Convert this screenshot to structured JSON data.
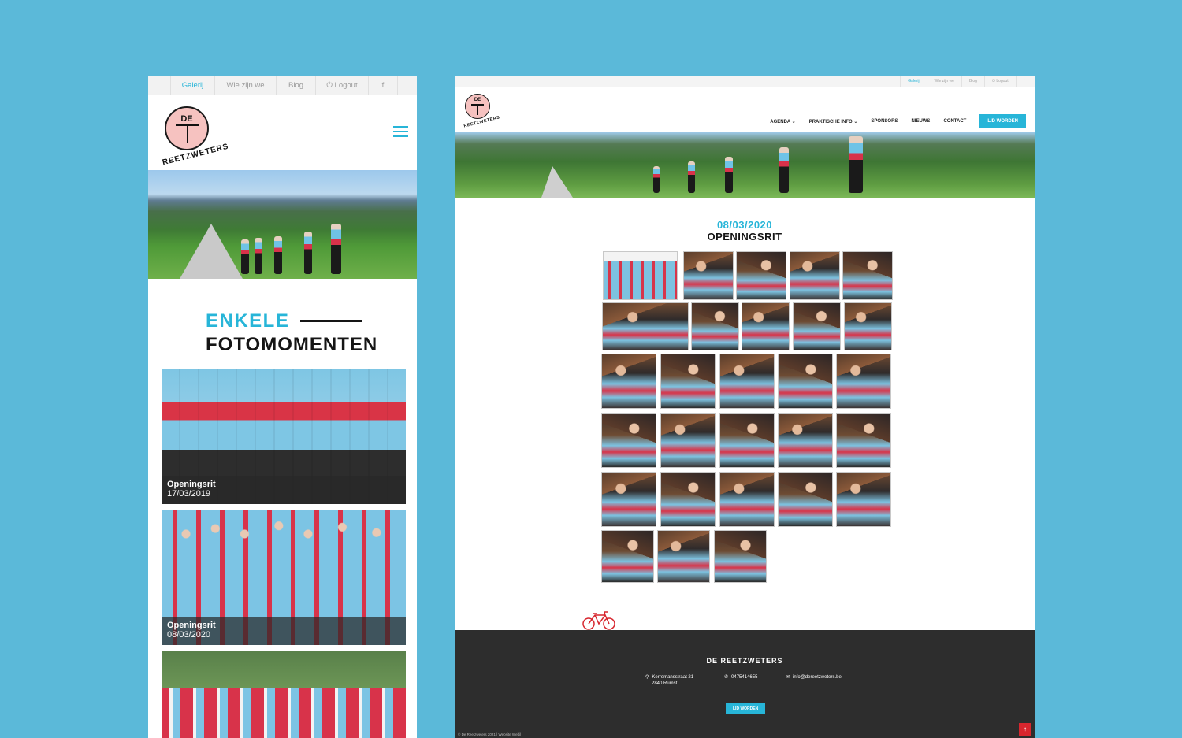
{
  "colors": {
    "background": "#5bb9d9",
    "accent": "#27b5d8",
    "danger": "#d7262e"
  },
  "mobile": {
    "topbar": {
      "tabs": [
        {
          "label": "Galerij",
          "active": true
        },
        {
          "label": "Wie zijn we"
        },
        {
          "label": "Blog"
        },
        {
          "label": "⏻ Logout"
        },
        {
          "label": "f",
          "icon": "facebook-icon"
        }
      ]
    },
    "logo": {
      "de": "DE",
      "arc": "REETZWETERS"
    },
    "heading": {
      "line1": "ENKELE",
      "line2": "FOTOMOMENTEN"
    },
    "cards": [
      {
        "title": "Openingsrit",
        "date": "17/03/2019"
      },
      {
        "title": "Openingsrit",
        "date": "08/03/2020"
      }
    ]
  },
  "desktop": {
    "topbar": {
      "tabs": [
        {
          "label": "Galerij",
          "active": true
        },
        {
          "label": "Wie zijn we"
        },
        {
          "label": "Blog"
        },
        {
          "label": "⏻ Logout"
        },
        {
          "label": "f",
          "icon": "facebook-icon"
        }
      ]
    },
    "nav": {
      "items": [
        "AGENDA ⌄",
        "PRAKTISCHE INFO ⌄",
        "SPONSORS",
        "NIEUWS",
        "CONTACT"
      ],
      "cta": "LID WORDEN"
    },
    "gallery": {
      "date": "08/03/2020",
      "title": "OPENINGSRIT",
      "photo_count": 28
    },
    "footer": {
      "brand": "DE REETZWETERS",
      "address_line1": "Kerremansstraat 21",
      "address_line2": "2840 Rumst",
      "phone": "0475414655",
      "email": "info@dereetzweters.be",
      "cta": "LID WORDEN",
      "copyright": "© De Reetzweters 2021 | Website Webil",
      "to_top": "↑"
    }
  }
}
